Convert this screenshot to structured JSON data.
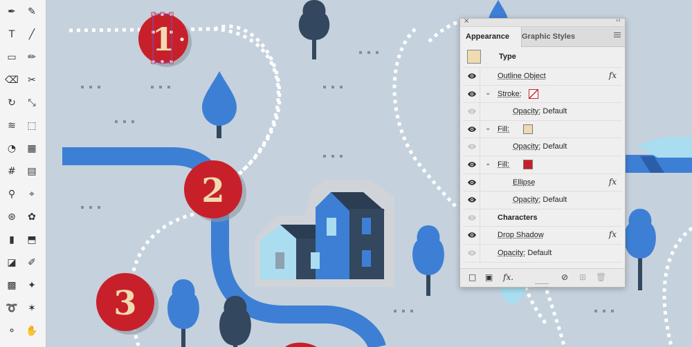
{
  "colors": {
    "background": "#c5d1dc",
    "road": "#3d7fd4",
    "marker_red": "#c8202a",
    "marker_number": "#f0dbb0",
    "tree_blue": "#3d7fd4",
    "tree_dark": "#33475e",
    "house_light": "#8fd3ea",
    "dots": "#ffffff"
  },
  "map": {
    "markers": [
      {
        "label": "1",
        "selected": true
      },
      {
        "label": "2",
        "selected": false
      },
      {
        "label": "3",
        "selected": false
      }
    ]
  },
  "tools_panel": {
    "icons": [
      "pen-icon",
      "curvature-icon",
      "type-icon",
      "line-icon",
      "rectangle-icon",
      "pencil-icon",
      "eraser-icon",
      "scissors-icon",
      "rotate-icon",
      "scale-icon",
      "width-icon",
      "free-transform-icon",
      "shape-builder-icon",
      "perspective-icon",
      "mesh-icon",
      "gradient-icon",
      "eyedropper-icon",
      "measure-icon",
      "blend-icon",
      "symbol-sprayer-icon",
      "graph-icon",
      "artboard-icon",
      "slice-icon",
      "eraser-brush-icon",
      "pattern-icon",
      "shaper-icon",
      "lasso-icon",
      "puppet-warp-icon",
      "zoom-icon",
      "hand-icon"
    ]
  },
  "appearance_panel": {
    "close_icon": "×",
    "collapse_icon": "‹‹",
    "tabs": [
      {
        "label": "Appearance",
        "active": true
      },
      {
        "label": "Graphic Styles",
        "active": false
      }
    ],
    "header": {
      "label": "Type",
      "swatch_color": "#f0dbb0"
    },
    "rows": [
      {
        "name": "outline-object",
        "label": "Outline Object",
        "eye": true,
        "fx": true
      },
      {
        "name": "stroke",
        "label": "Stroke:",
        "eye": true,
        "chevron": true,
        "swatch": "none"
      },
      {
        "name": "stroke-opacity",
        "label": "Opacity:",
        "value": "Default",
        "eye": false,
        "indent": true
      },
      {
        "name": "fill-1",
        "label": "Fill:",
        "eye": true,
        "chevron": true,
        "swatch": "#f0dbb0"
      },
      {
        "name": "fill-1-opacity",
        "label": "Opacity:",
        "value": "Default",
        "eye": false,
        "indent": true
      },
      {
        "name": "fill-2",
        "label": "Fill:",
        "eye": true,
        "chevron": true,
        "swatch": "#c8202a"
      },
      {
        "name": "ellipse",
        "label": "Ellipse",
        "eye": true,
        "fx": true,
        "indent": true
      },
      {
        "name": "fill-2-opacity",
        "label": "Opacity:",
        "value": "Default",
        "eye": true,
        "indent": true
      },
      {
        "name": "characters",
        "label": "Characters",
        "eye": false,
        "bold": true
      },
      {
        "name": "drop-shadow",
        "label": "Drop Shadow",
        "eye": true,
        "fx": true
      },
      {
        "name": "opacity",
        "label": "Opacity:",
        "value": "Default",
        "eye": false
      }
    ],
    "fx_label": "fx",
    "bottom_bar": {
      "fx_label": "fx."
    }
  }
}
